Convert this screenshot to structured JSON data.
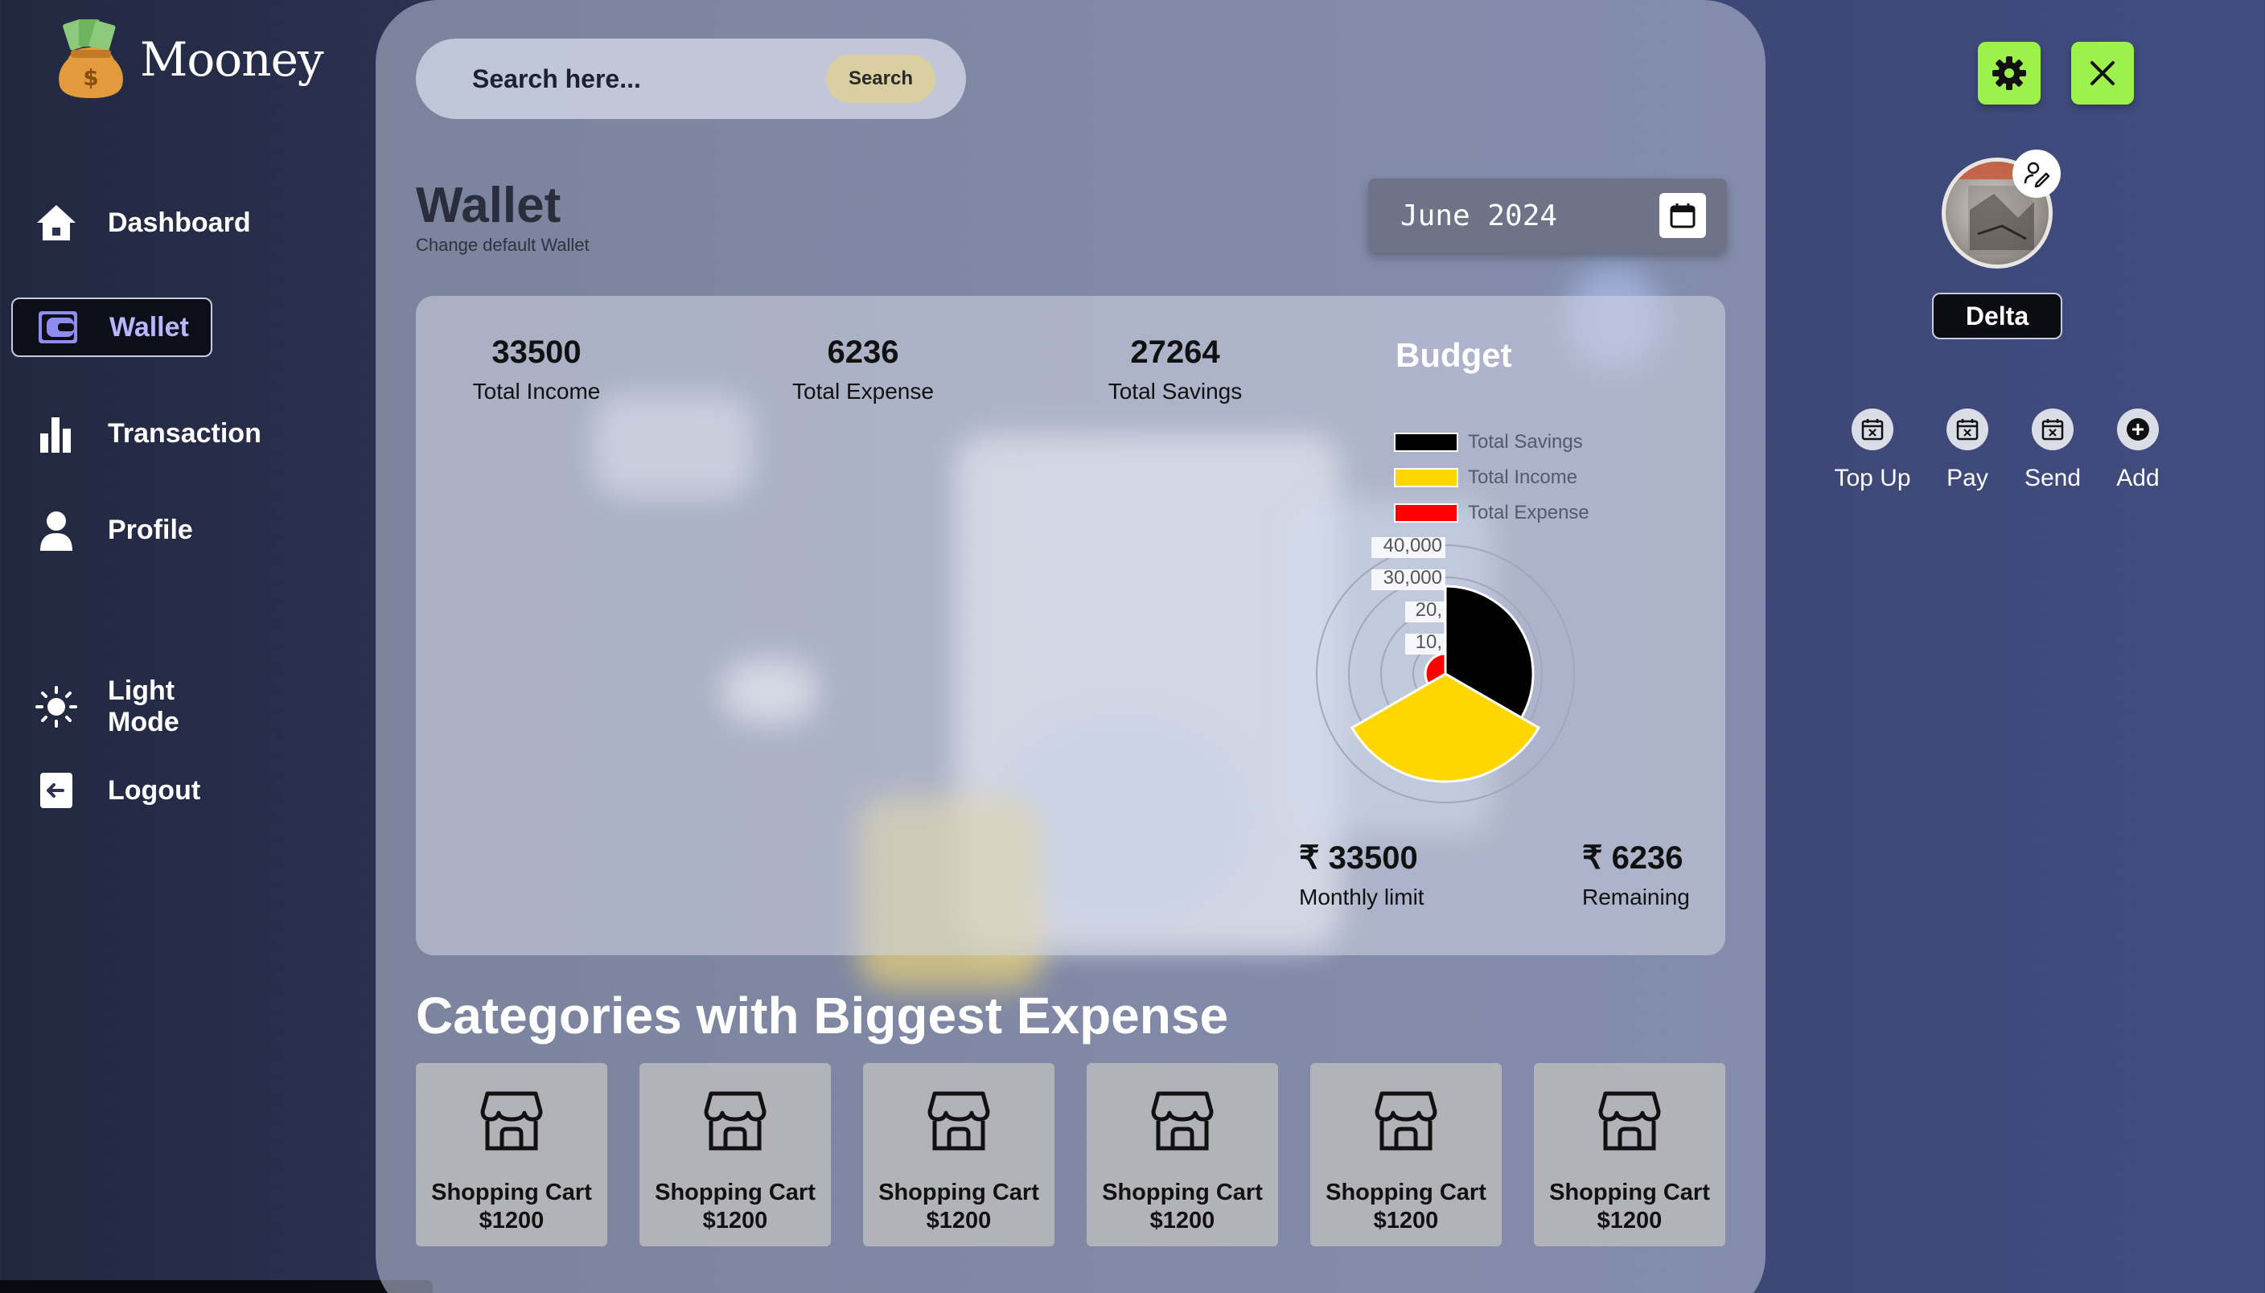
{
  "app": {
    "name": "Mooney"
  },
  "sidebar": {
    "items": [
      {
        "label": "Dashboard",
        "icon": "home-icon"
      },
      {
        "label": "Wallet",
        "icon": "wallet-icon",
        "active": true
      },
      {
        "label": "Transaction",
        "icon": "bar-chart-icon"
      },
      {
        "label": "Profile",
        "icon": "user-icon"
      },
      {
        "label": "Light Mode",
        "icon": "sun-icon"
      },
      {
        "label": "Logout",
        "icon": "logout-icon"
      }
    ]
  },
  "search": {
    "placeholder": "Search here...",
    "button_label": "Search"
  },
  "page": {
    "title": "Wallet",
    "subtitle": "Change default Wallet"
  },
  "date_picker": {
    "value": "June 2024"
  },
  "stats": [
    {
      "value": "33500",
      "label": "Total Income"
    },
    {
      "value": "6236",
      "label": "Total Expense"
    },
    {
      "value": "27264",
      "label": "Total Savings"
    }
  ],
  "budget": {
    "title": "Budget",
    "monthly_limit": {
      "value": "₹ 33500",
      "label": "Monthly limit"
    },
    "remaining": {
      "value": "₹ 6236",
      "label": "Remaining"
    }
  },
  "chart_data": {
    "type": "polarArea",
    "title": "Budget",
    "categories": [
      "Total Savings",
      "Total Income",
      "Total Expense"
    ],
    "values": [
      27264,
      33500,
      6236
    ],
    "colors": [
      "#000000",
      "#ffd600",
      "#ff0000"
    ],
    "radial_ticks": [
      "10,",
      "20,",
      "30,000",
      "40,000"
    ],
    "rmax": 40000,
    "legend_position": "top"
  },
  "categories_section": {
    "title": "Categories with Biggest Expense",
    "items": [
      {
        "name": "Shopping Cart",
        "amount": "$1200"
      },
      {
        "name": "Shopping Cart",
        "amount": "$1200"
      },
      {
        "name": "Shopping Cart",
        "amount": "$1200"
      },
      {
        "name": "Shopping Cart",
        "amount": "$1200"
      },
      {
        "name": "Shopping Cart",
        "amount": "$1200"
      },
      {
        "name": "Shopping Cart",
        "amount": "$1200"
      }
    ]
  },
  "user": {
    "name": "Delta"
  },
  "quick_actions": [
    {
      "label": "Top Up"
    },
    {
      "label": "Pay"
    },
    {
      "label": "Send"
    },
    {
      "label": "Add"
    }
  ],
  "colors": {
    "accent_green": "#9cf24a",
    "active_label": "#b8b6ff",
    "income": "#ffd600",
    "expense": "#ff0000",
    "savings": "#000000"
  }
}
